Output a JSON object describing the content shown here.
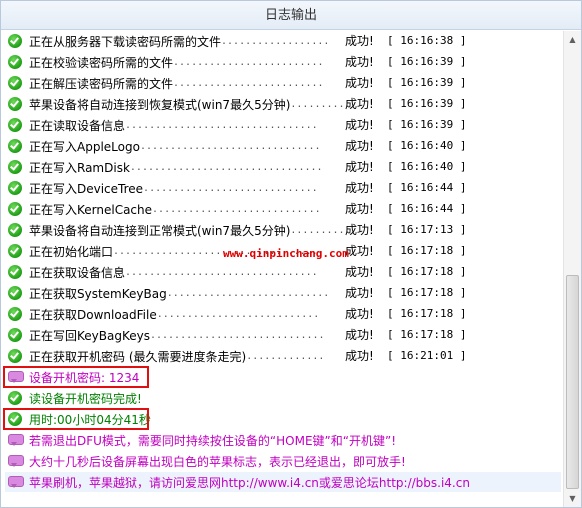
{
  "window": {
    "title": "日志输出"
  },
  "log": {
    "rows": [
      {
        "icon": "check",
        "text": "正在从服务器下载读密码所需的文件",
        "dots": "..................",
        "status": "成功!",
        "time": "[ 16:16:38 ]"
      },
      {
        "icon": "check",
        "text": "正在校验读密码所需的文件",
        "dots": ".........................",
        "status": "成功!",
        "time": "[ 16:16:39 ]"
      },
      {
        "icon": "check",
        "text": "正在解压读密码所需的文件",
        "dots": ".........................",
        "status": "成功!",
        "time": "[ 16:16:39 ]"
      },
      {
        "icon": "check",
        "text": "苹果设备将自动连接到恢复模式(win7最久5分钟)",
        "dots": "..........",
        "status": "成功!",
        "time": "[ 16:16:39 ]"
      },
      {
        "icon": "check",
        "text": "正在读取设备信息",
        "dots": "................................",
        "status": "成功!",
        "time": "[ 16:16:39 ]"
      },
      {
        "icon": "check",
        "text": "正在写入AppleLogo",
        "dots": "..............................",
        "status": "成功!",
        "time": "[ 16:16:40 ]"
      },
      {
        "icon": "check",
        "text": "正在写入RamDisk",
        "dots": "................................",
        "status": "成功!",
        "time": "[ 16:16:40 ]"
      },
      {
        "icon": "check",
        "text": "正在写入DeviceTree",
        "dots": ".............................",
        "status": "成功!",
        "time": "[ 16:16:44 ]"
      },
      {
        "icon": "check",
        "text": "正在写入KernelCache",
        "dots": "............................",
        "status": "成功!",
        "time": "[ 16:16:44 ]"
      },
      {
        "icon": "check",
        "text": "苹果设备将自动连接到正常模式(win7最久5分钟)",
        "dots": "..........",
        "status": "成功!",
        "time": "[ 16:17:13 ]"
      },
      {
        "icon": "check",
        "text": "正在初始化端口",
        "dots": "..................................",
        "status": "成功!",
        "time": "[ 16:17:18 ]"
      },
      {
        "icon": "check",
        "text": "正在获取设备信息",
        "dots": "................................",
        "status": "成功!",
        "time": "[ 16:17:18 ]"
      },
      {
        "icon": "check",
        "text": "正在获取SystemKeyBag",
        "dots": "...........................",
        "status": "成功!",
        "time": "[ 16:17:18 ]"
      },
      {
        "icon": "check",
        "text": "正在获取DownloadFile",
        "dots": "...........................",
        "status": "成功!",
        "time": "[ 16:17:18 ]"
      },
      {
        "icon": "check",
        "text": "正在写回KeyBagKeys",
        "dots": ".............................",
        "status": "成功!",
        "time": "[ 16:17:18 ]"
      },
      {
        "icon": "check",
        "text": "正在获取开机密码 (最久需要进度条走完)",
        "dots": ".............",
        "status": "成功!",
        "time": "[ 16:21:01 ]"
      }
    ],
    "password_line": "设备开机密码: 1234",
    "read_done": "读设备开机密码完成!",
    "elapsed": "用时:00小时04分41秒",
    "tip1": "若需退出DFU模式，需要同时持续按住设备的“HOME键”和“开机键”!",
    "tip2": "大约十几秒后设备屏幕出现白色的苹果标志，表示已经退出，即可放手!",
    "tip3": "苹果刷机，苹果越狱，请访问爱思网http://www.i4.cn或爱思论坛http://bbs.i4.cn"
  },
  "watermark": "www.qinpinchang.com",
  "colors": {
    "purple": "#c000c0",
    "green": "#008000",
    "highlight": "#e01010"
  }
}
